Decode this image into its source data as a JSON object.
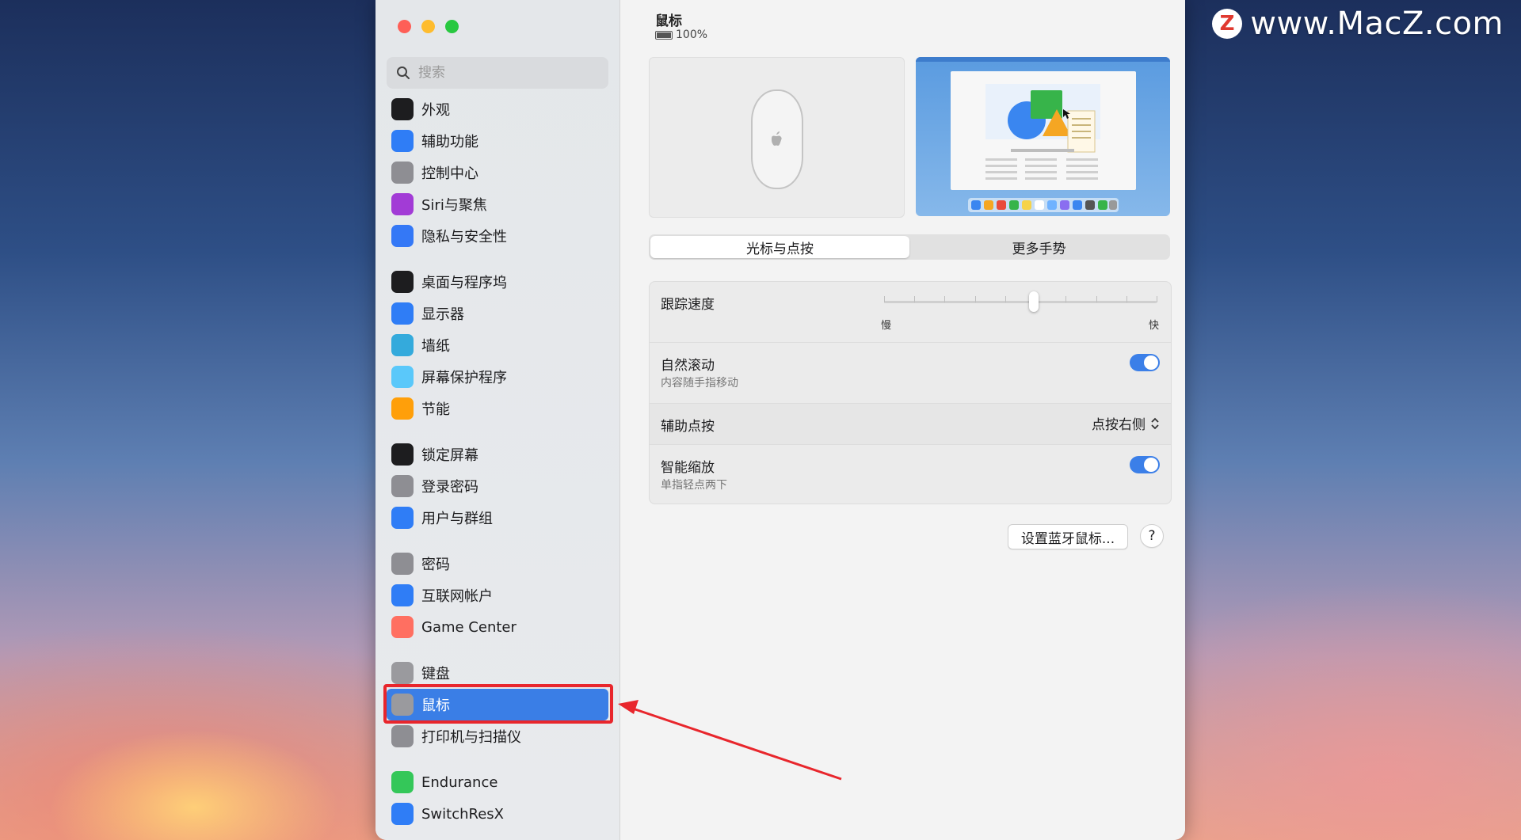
{
  "watermark": {
    "logo": "Z",
    "text": "www.MacZ.com"
  },
  "search": {
    "placeholder": "搜索"
  },
  "sidebar": {
    "items": [
      {
        "label": "外观",
        "icon": "appearance-icon",
        "color": "#1d1d1f"
      },
      {
        "label": "辅助功能",
        "icon": "accessibility-icon",
        "color": "#2f7df6"
      },
      {
        "label": "控制中心",
        "icon": "control-center-icon",
        "color": "#8e8e93"
      },
      {
        "label": "Siri与聚焦",
        "icon": "siri-icon",
        "color": "#a23bd6"
      },
      {
        "label": "隐私与安全性",
        "icon": "privacy-hand-icon",
        "color": "#3478f6"
      },
      {
        "label": "桌面与程序坞",
        "icon": "dock-icon",
        "color": "#1d1d1f"
      },
      {
        "label": "显示器",
        "icon": "display-icon",
        "color": "#2f7df6"
      },
      {
        "label": "墙纸",
        "icon": "wallpaper-icon",
        "color": "#34aadc"
      },
      {
        "label": "屏幕保护程序",
        "icon": "screensaver-icon",
        "color": "#5ac8fa"
      },
      {
        "label": "节能",
        "icon": "energy-bulb-icon",
        "color": "#ff9f0a"
      },
      {
        "label": "锁定屏幕",
        "icon": "lock-screen-icon",
        "color": "#1d1d1f"
      },
      {
        "label": "登录密码",
        "icon": "lock-icon",
        "color": "#8e8e93"
      },
      {
        "label": "用户与群组",
        "icon": "users-icon",
        "color": "#2f7df6"
      },
      {
        "label": "密码",
        "icon": "key-icon",
        "color": "#8e8e93"
      },
      {
        "label": "互联网帐户",
        "icon": "at-icon",
        "color": "#2f7df6"
      },
      {
        "label": "Game Center",
        "icon": "game-center-icon",
        "color": "#ff6f61"
      },
      {
        "label": "键盘",
        "icon": "keyboard-icon",
        "color": "#9a9a9e"
      },
      {
        "label": "鼠标",
        "icon": "mouse-icon",
        "color": "#9a9a9e"
      },
      {
        "label": "打印机与扫描仪",
        "icon": "printer-icon",
        "color": "#8e8e93"
      },
      {
        "label": "Endurance",
        "icon": "endurance-icon",
        "color": "#34c759"
      },
      {
        "label": "SwitchResX",
        "icon": "monitor-icon",
        "color": "#2f7df6"
      }
    ]
  },
  "main": {
    "title": "鼠标",
    "battery": "100%",
    "tabs": [
      "光标与点按",
      "更多手势"
    ],
    "tracking": {
      "label": "跟踪速度",
      "min_label": "慢",
      "max_label": "快",
      "value": 0.55
    },
    "natural_scroll": {
      "label": "自然滚动",
      "sub": "内容随手指移动",
      "on": true
    },
    "secondary_click": {
      "label": "辅助点按",
      "value": "点按右侧"
    },
    "smart_zoom": {
      "label": "智能缩放",
      "sub": "单指轻点两下",
      "on": true
    },
    "bluetooth_button": "设置蓝牙鼠标...",
    "help_button": "?"
  }
}
